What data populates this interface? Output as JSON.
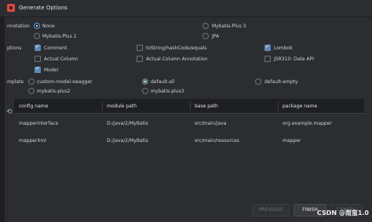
{
  "window": {
    "title": "Generate Options"
  },
  "annotation": {
    "label": "nnotation",
    "options": [
      "None",
      "Mybatis-Plus 3",
      "Mybatis-Plus 2",
      "JPA"
    ]
  },
  "options": {
    "label": "ptions",
    "items": [
      "Comment",
      "toString/hashCode/equals",
      "Lombok",
      "Actual Column",
      "Actual Column Annotation",
      "JSR310: Date API",
      "Model"
    ]
  },
  "template": {
    "label": "mplate",
    "options": [
      "custom-model-swagger",
      "default-all",
      "default-empty",
      "mybatis-plus2",
      "mybatis-plus3"
    ]
  },
  "table": {
    "headers": [
      "config name",
      "module path",
      "base path",
      "package name"
    ],
    "rows": [
      [
        "mapperInterface",
        "D:/java/2/MyBatis",
        "src/main/java",
        "org.example.mapper"
      ],
      [
        "mapperXml",
        "D:/java/2/MyBatis",
        "src/main/resources",
        "mapper"
      ]
    ]
  },
  "buttons": {
    "previous": "PREVIOUS",
    "finish": "FINISH",
    "cancel": "CANCEL"
  },
  "watermark": "CSDN @南蛮1.0"
}
